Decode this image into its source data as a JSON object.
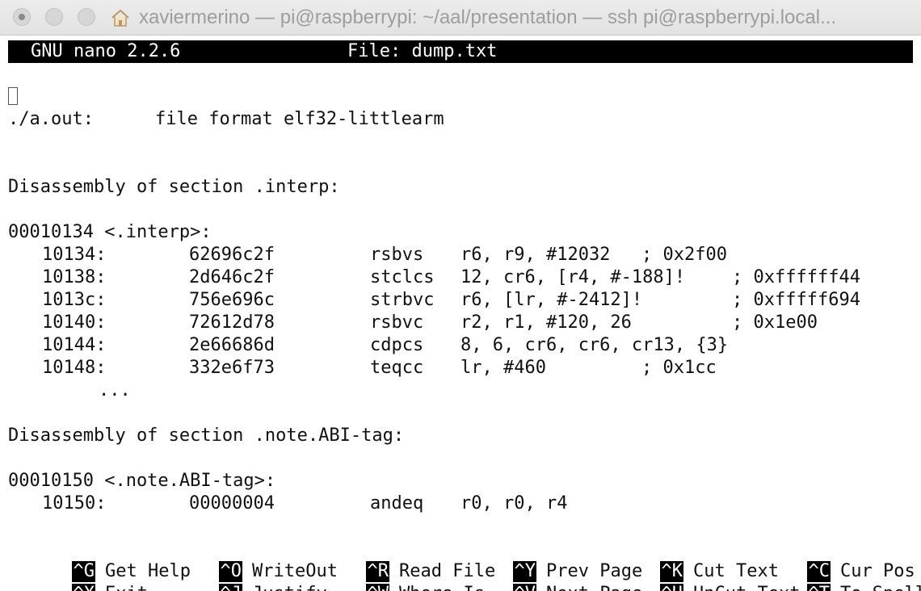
{
  "window": {
    "title": "xaviermerino — pi@raspberrypi: ~/aal/presentation — ssh pi@raspberrypi.local..."
  },
  "nano": {
    "version": "GNU nano 2.2.6",
    "file": "File: dump.txt"
  },
  "content": {
    "file_format_label": "./a.out:",
    "file_format_value": "file format elf32-littlearm",
    "section1_header": "Disassembly of section .interp:",
    "section1_symbol": "00010134 <.interp>:",
    "section1_rows": [
      {
        "addr": "10134:",
        "hex": "62696c2f",
        "mnem": "rsbvs",
        "ops": "r6, r9, #12032",
        "comment": "; 0x2f00"
      },
      {
        "addr": "10138:",
        "hex": "2d646c2f",
        "mnem": "stclcs",
        "ops": "12, cr6, [r4, #-188]!",
        "comment": "; 0xffffff44"
      },
      {
        "addr": "1013c:",
        "hex": "756e696c",
        "mnem": "strbvc",
        "ops": "r6, [lr, #-2412]!",
        "comment": "; 0xfffff694"
      },
      {
        "addr": "10140:",
        "hex": "72612d78",
        "mnem": "rsbvc",
        "ops": "r2, r1, #120, 26",
        "comment": "; 0x1e00"
      },
      {
        "addr": "10144:",
        "hex": "2e66686d",
        "mnem": "cdpcs",
        "ops": "8, 6, cr6, cr6, cr13, {3}",
        "comment": ""
      },
      {
        "addr": "10148:",
        "hex": "332e6f73",
        "mnem": "teqcc",
        "ops": "lr, #460",
        "comment": "; 0x1cc"
      }
    ],
    "ellipsis": "...",
    "section2_header": "Disassembly of section .note.ABI-tag:",
    "section2_symbol": "00010150 <.note.ABI-tag>:",
    "section2_rows": [
      {
        "addr": "10150:",
        "hex": "00000004",
        "mnem": "andeq",
        "ops": "r0, r0, r4",
        "comment": ""
      }
    ]
  },
  "shortcuts": {
    "get_help": {
      "key": "^G",
      "label": "Get Help"
    },
    "exit": {
      "key": "^X",
      "label": "Exit"
    },
    "writeout": {
      "key": "^O",
      "label": "WriteOut"
    },
    "justify": {
      "key": "^J",
      "label": "Justify"
    },
    "read_file": {
      "key": "^R",
      "label": "Read File"
    },
    "where_is": {
      "key": "^W",
      "label": "Where Is"
    },
    "prev_page": {
      "key": "^Y",
      "label": "Prev Page"
    },
    "next_page": {
      "key": "^V",
      "label": "Next Page"
    },
    "cut_text": {
      "key": "^K",
      "label": "Cut Text"
    },
    "uncut_text": {
      "key": "^U",
      "label": "UnCut Text"
    },
    "cur_pos": {
      "key": "^C",
      "label": "Cur Pos"
    },
    "to_spell": {
      "key": "^T",
      "label": "To Spell"
    }
  }
}
